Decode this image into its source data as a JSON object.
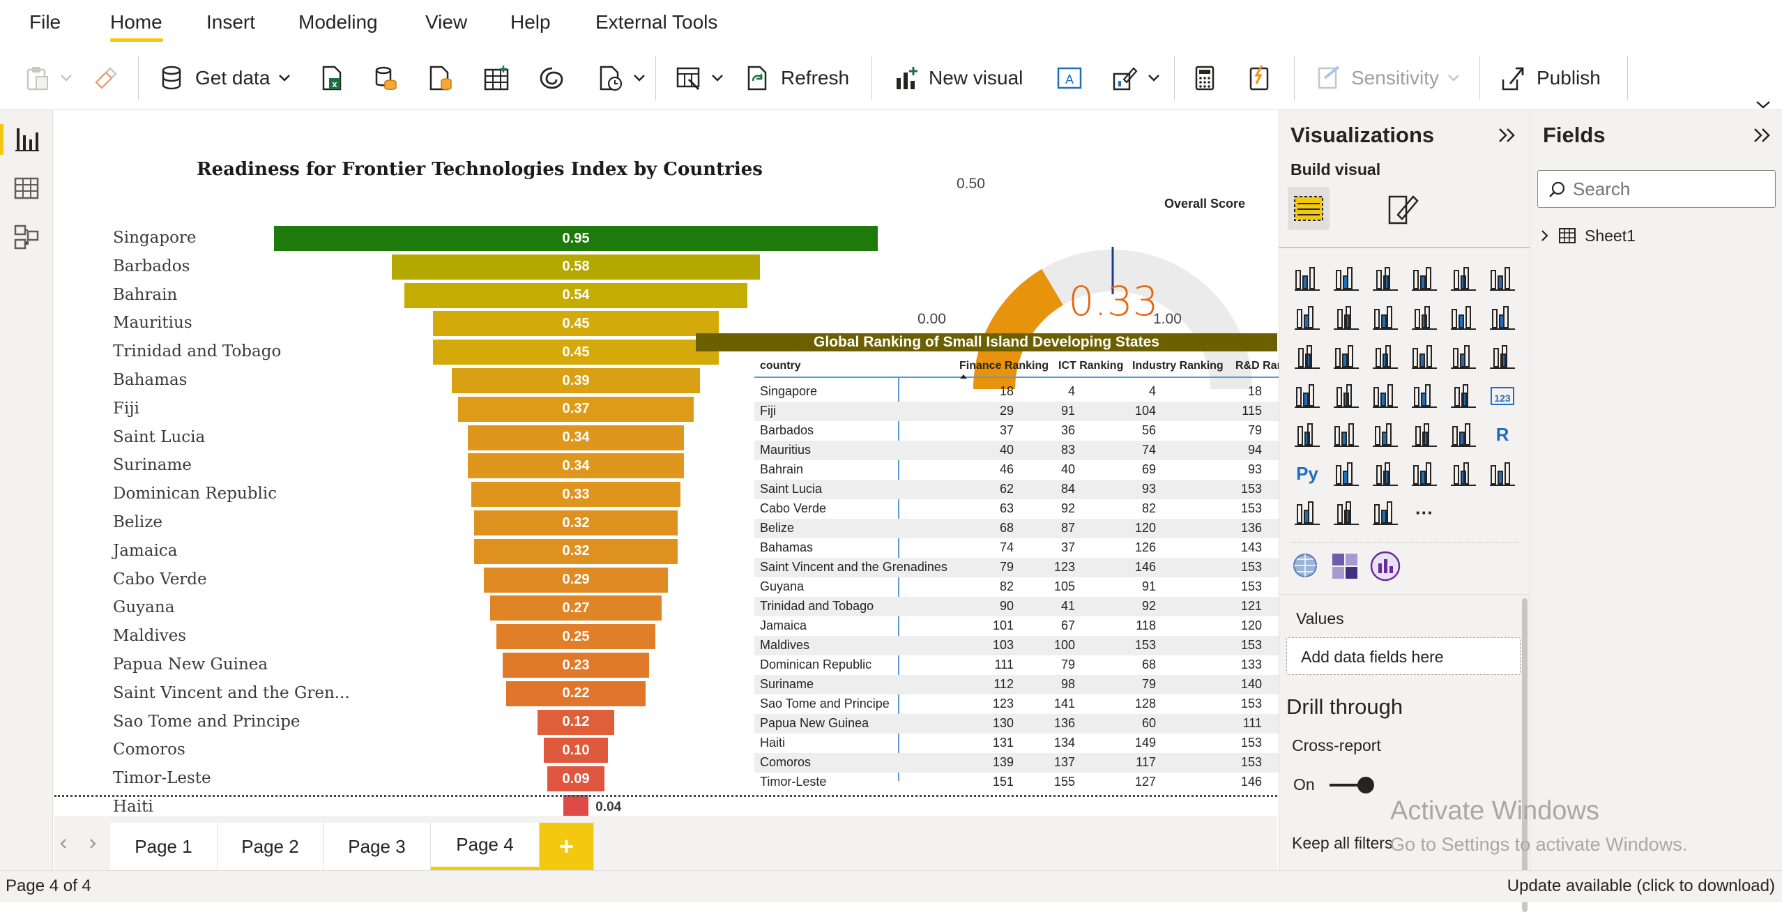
{
  "menu": {
    "file": "File",
    "home": "Home",
    "insert": "Insert",
    "modeling": "Modeling",
    "view": "View",
    "help": "Help",
    "external_tools": "External Tools"
  },
  "toolbar": {
    "get_data": "Get data",
    "refresh": "Refresh",
    "new_visual": "New visual",
    "sensitivity": "Sensitivity",
    "publish": "Publish"
  },
  "funnel": {
    "title": "Readiness for Frontier Technologies Index by Countries",
    "rows": [
      {
        "country": "Singapore",
        "value": "0.95",
        "color": "#1f7a0c"
      },
      {
        "country": "Barbados",
        "value": "0.58",
        "color": "#b5a800"
      },
      {
        "country": "Bahrain",
        "value": "0.54",
        "color": "#c4ac00"
      },
      {
        "country": "Mauritius",
        "value": "0.45",
        "color": "#d4a90a"
      },
      {
        "country": "Trinidad and Tobago",
        "value": "0.45",
        "color": "#d4a90a"
      },
      {
        "country": "Bahamas",
        "value": "0.39",
        "color": "#d9a014"
      },
      {
        "country": "Fiji",
        "value": "0.37",
        "color": "#dc9c18"
      },
      {
        "country": "Saint Lucia",
        "value": "0.34",
        "color": "#de971c"
      },
      {
        "country": "Suriname",
        "value": "0.34",
        "color": "#de971c"
      },
      {
        "country": "Dominican Republic",
        "value": "0.33",
        "color": "#df941e"
      },
      {
        "country": "Belize",
        "value": "0.32",
        "color": "#df9120"
      },
      {
        "country": "Jamaica",
        "value": "0.32",
        "color": "#df9120"
      },
      {
        "country": "Cabo Verde",
        "value": "0.29",
        "color": "#e08a24"
      },
      {
        "country": "Guyana",
        "value": "0.27",
        "color": "#e08526"
      },
      {
        "country": "Maldives",
        "value": "0.25",
        "color": "#e07f28"
      },
      {
        "country": "Papua New Guinea",
        "value": "0.23",
        "color": "#e0792a"
      },
      {
        "country": "Saint Vincent and the Gren...",
        "value": "0.22",
        "color": "#e0762c"
      },
      {
        "country": "Sao Tome and Principe",
        "value": "0.12",
        "color": "#df5f3a"
      },
      {
        "country": "Comoros",
        "value": "0.10",
        "color": "#df5a3c"
      },
      {
        "country": "Timor-Leste",
        "value": "0.09",
        "color": "#df5640"
      },
      {
        "country": "Haiti",
        "value": "0.04",
        "color": "#df4a48"
      }
    ]
  },
  "gauge": {
    "min": "0.00",
    "max": "1.00",
    "target": "0.50",
    "value": "0.33",
    "label": "Overall Score",
    "value_fraction": 0.33,
    "target_fraction": 0.5
  },
  "table": {
    "title": "Global Ranking of Small Island Developing States",
    "headers": [
      "country",
      "Finance Ranking",
      "ICT Ranking",
      "Industry Ranking",
      "R&D Ranking"
    ],
    "rows": [
      [
        "Singapore",
        "18",
        "4",
        "4",
        "18"
      ],
      [
        "Fiji",
        "29",
        "91",
        "104",
        "115"
      ],
      [
        "Barbados",
        "37",
        "36",
        "56",
        "79"
      ],
      [
        "Mauritius",
        "40",
        "83",
        "74",
        "94"
      ],
      [
        "Bahrain",
        "46",
        "40",
        "69",
        "93"
      ],
      [
        "Saint Lucia",
        "62",
        "84",
        "93",
        "153"
      ],
      [
        "Cabo Verde",
        "63",
        "92",
        "82",
        "153"
      ],
      [
        "Belize",
        "68",
        "87",
        "120",
        "136"
      ],
      [
        "Bahamas",
        "74",
        "37",
        "126",
        "143"
      ],
      [
        "Saint Vincent and the Grenadines",
        "79",
        "123",
        "146",
        "153"
      ],
      [
        "Guyana",
        "82",
        "105",
        "91",
        "153"
      ],
      [
        "Trinidad and Tobago",
        "90",
        "41",
        "92",
        "121"
      ],
      [
        "Jamaica",
        "101",
        "67",
        "118",
        "120"
      ],
      [
        "Maldives",
        "103",
        "100",
        "153",
        "153"
      ],
      [
        "Dominican Republic",
        "111",
        "79",
        "68",
        "133"
      ],
      [
        "Suriname",
        "112",
        "98",
        "79",
        "140"
      ],
      [
        "Sao Tome and Principe",
        "123",
        "141",
        "128",
        "153"
      ],
      [
        "Papua New Guinea",
        "130",
        "136",
        "60",
        "111"
      ],
      [
        "Haiti",
        "131",
        "134",
        "149",
        "153"
      ],
      [
        "Comoros",
        "139",
        "137",
        "117",
        "153"
      ],
      [
        "Timor-Leste",
        "151",
        "155",
        "127",
        "146"
      ]
    ]
  },
  "pages": {
    "tabs": [
      "Page 1",
      "Page 2",
      "Page 3",
      "Page 4"
    ],
    "add": "+"
  },
  "viz": {
    "title": "Visualizations",
    "build_visual": "Build visual",
    "values": "Values",
    "add_fields": "Add data fields here",
    "drill_through": "Drill through",
    "cross_report": "Cross-report",
    "on": "On",
    "keep_filters": "Keep all filters"
  },
  "fields": {
    "title": "Fields",
    "search_placeholder": "Search",
    "sheet": "Sheet1"
  },
  "watermark": {
    "line1": "Activate Windows",
    "line2": "Go to Settings to activate Windows."
  },
  "status": {
    "page": "Page 4 of 4",
    "update": "Update available (click to download)"
  },
  "colors": {
    "accent": "#f2c811",
    "gauge_fill": "#e8930c",
    "gauge_value_text": "#e8650c",
    "table_header": "#6b5f00"
  }
}
